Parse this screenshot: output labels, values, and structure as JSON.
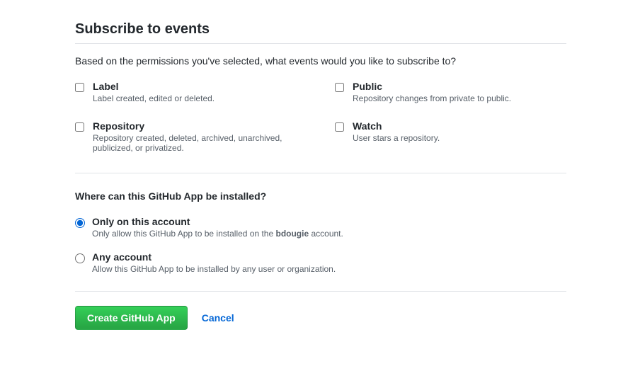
{
  "section": {
    "title": "Subscribe to events",
    "description": "Based on the permissions you've selected, what events would you like to subscribe to?"
  },
  "events": [
    {
      "title": "Label",
      "desc": "Label created, edited or deleted."
    },
    {
      "title": "Public",
      "desc": "Repository changes from private to public."
    },
    {
      "title": "Repository",
      "desc": "Repository created, deleted, archived, unarchived, publicized, or privatized."
    },
    {
      "title": "Watch",
      "desc": "User stars a repository."
    }
  ],
  "install": {
    "question": "Where can this GitHub App be installed?",
    "options": [
      {
        "title": "Only on this account",
        "desc_prefix": "Only allow this GitHub App to be installed on the ",
        "desc_bold": "bdougie",
        "desc_suffix": " account.",
        "selected": true
      },
      {
        "title": "Any account",
        "desc_prefix": "Allow this GitHub App to be installed by any user or organization.",
        "desc_bold": "",
        "desc_suffix": "",
        "selected": false
      }
    ]
  },
  "actions": {
    "create_label": "Create GitHub App",
    "cancel_label": "Cancel"
  }
}
